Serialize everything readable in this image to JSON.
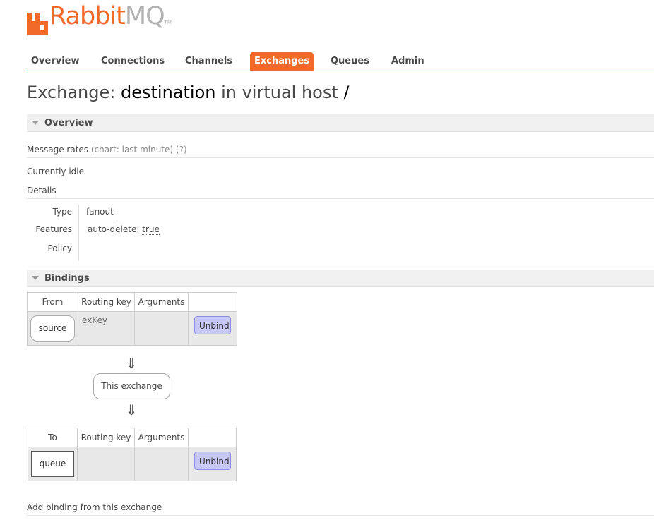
{
  "logo": {
    "rabbit": "Rabbit",
    "mq": "MQ",
    "tm": "TM"
  },
  "nav": {
    "tabs": [
      {
        "label": "Overview",
        "active": false
      },
      {
        "label": "Connections",
        "active": false
      },
      {
        "label": "Channels",
        "active": false
      },
      {
        "label": "Exchanges",
        "active": true
      },
      {
        "label": "Queues",
        "active": false
      },
      {
        "label": "Admin",
        "active": false
      }
    ]
  },
  "heading": {
    "prefix": "Exchange: ",
    "name": "destination",
    "middle": " in virtual host ",
    "vhost": "/"
  },
  "overview": {
    "title": "Overview",
    "message_rates": "Message rates",
    "chart_range": "(chart: last minute)",
    "help": "(?)",
    "status": "Currently idle",
    "details_title": "Details",
    "details": {
      "type_label": "Type",
      "type_value": "fanout",
      "features_label": "Features",
      "features_key": "auto-delete:",
      "features_value": "true",
      "policy_label": "Policy",
      "policy_value": ""
    }
  },
  "bindings": {
    "title": "Bindings",
    "incoming": {
      "headers": [
        "From",
        "Routing key",
        "Arguments",
        ""
      ],
      "rows": [
        {
          "from": "source",
          "routing_key": "exKey",
          "arguments": "",
          "action": "Unbind"
        }
      ]
    },
    "arrow": "⇓",
    "this_exchange": "This exchange",
    "outgoing": {
      "headers": [
        "To",
        "Routing key",
        "Arguments",
        ""
      ],
      "rows": [
        {
          "to": "queue",
          "routing_key": "",
          "arguments": "",
          "action": "Unbind"
        }
      ]
    },
    "add_binding": "Add binding from this exchange"
  },
  "colors": {
    "brand": "#f16a2a",
    "unbind_bg": "#c8c8f4"
  }
}
